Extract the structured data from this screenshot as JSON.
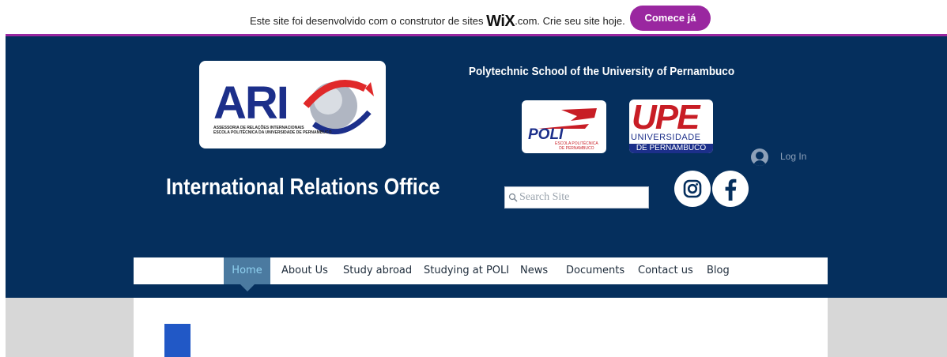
{
  "wix_banner": {
    "text_before": "Este site foi desenvolvido com o construtor de sites ",
    "brand": "WiX",
    "text_after": ".com. Crie seu site hoje.",
    "cta_label": "Comece já",
    "accent_color": "#9a27a0"
  },
  "header": {
    "background_color": "#052f5d",
    "ari_logo": {
      "letters": "ARI",
      "subtitle_line1": "ASSESSORIA DE RELAÇÕES INTERNACIONAIS",
      "subtitle_line2": "ESCOLA POLITÉCNICA DA UNIVERSIDADE DE PERNAMBUCO"
    },
    "school_title": "Polytechnic School of the University of Pernambuco",
    "poli_logo": {
      "word": "POLI",
      "sub_line1": "ESCOLA POLITÉCNICA",
      "sub_line2": "DE PERNAMBUCO"
    },
    "upe_logo": {
      "word": "UPE",
      "line1": "UNIVERSIDADE",
      "line2": "DE PERNAMBUCO"
    },
    "login_label": "Log In",
    "office_title": "International Relations Office",
    "search_placeholder": "Search Site",
    "social": [
      {
        "name": "instagram-icon"
      },
      {
        "name": "facebook-icon"
      }
    ]
  },
  "nav": {
    "items": [
      {
        "label": "Home",
        "active": true
      },
      {
        "label": "About Us"
      },
      {
        "label": "Study abroad"
      },
      {
        "label": "Studying at POLI"
      },
      {
        "label": "News"
      },
      {
        "label": "Documents"
      },
      {
        "label": "Contact us"
      },
      {
        "label": "Blog"
      }
    ],
    "active_color": "#4b7aa0"
  },
  "content": {
    "block_color": "#2158c6"
  }
}
